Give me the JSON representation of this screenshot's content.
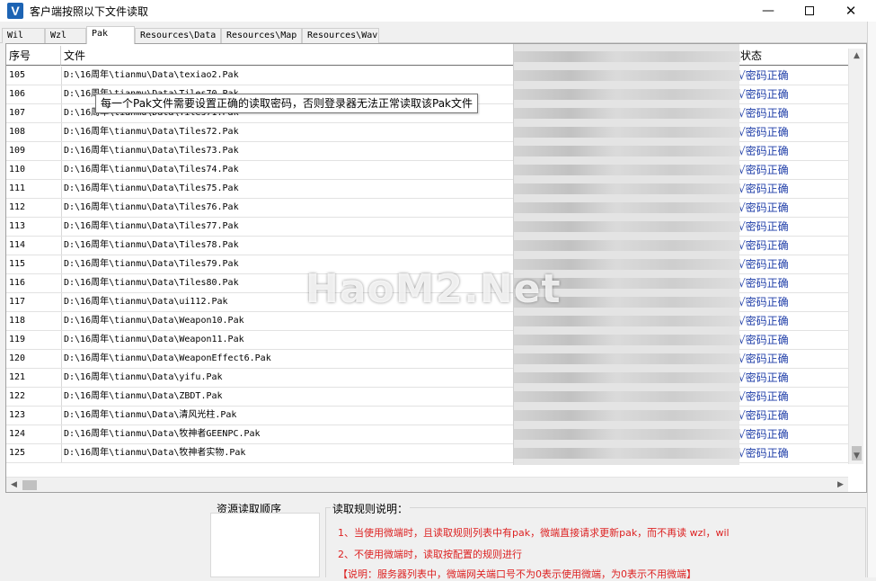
{
  "window": {
    "title": "客户端按照以下文件读取",
    "icon_letter": "V",
    "minimize": "—",
    "close": "✕"
  },
  "tabs": [
    "Wil",
    "Wzl",
    "Pak",
    "Resources\\Data",
    "Resources\\Map",
    "Resources\\Wav"
  ],
  "table": {
    "headers": {
      "index": "序号",
      "file": "文件",
      "status": "状态"
    },
    "rows": [
      {
        "index": "105",
        "file": "D:\\16周年\\tianmu\\Data\\texiao2.Pak",
        "status": "√密码正确"
      },
      {
        "index": "106",
        "file": "D:\\16周年\\tianmu\\Data\\Tiles70.Pak",
        "status": "√密码正确"
      },
      {
        "index": "107",
        "file": "D:\\16周年\\tianmu\\Data\\Tiles71.Pak",
        "status": "√密码正确"
      },
      {
        "index": "108",
        "file": "D:\\16周年\\tianmu\\Data\\Tiles72.Pak",
        "status": "√密码正确"
      },
      {
        "index": "109",
        "file": "D:\\16周年\\tianmu\\Data\\Tiles73.Pak",
        "status": "√密码正确"
      },
      {
        "index": "110",
        "file": "D:\\16周年\\tianmu\\Data\\Tiles74.Pak",
        "status": "√密码正确"
      },
      {
        "index": "111",
        "file": "D:\\16周年\\tianmu\\Data\\Tiles75.Pak",
        "status": "√密码正确"
      },
      {
        "index": "112",
        "file": "D:\\16周年\\tianmu\\Data\\Tiles76.Pak",
        "status": "√密码正确"
      },
      {
        "index": "113",
        "file": "D:\\16周年\\tianmu\\Data\\Tiles77.Pak",
        "status": "√密码正确"
      },
      {
        "index": "114",
        "file": "D:\\16周年\\tianmu\\Data\\Tiles78.Pak",
        "status": "√密码正确"
      },
      {
        "index": "115",
        "file": "D:\\16周年\\tianmu\\Data\\Tiles79.Pak",
        "status": "√密码正确"
      },
      {
        "index": "116",
        "file": "D:\\16周年\\tianmu\\Data\\Tiles80.Pak",
        "status": "√密码正确"
      },
      {
        "index": "117",
        "file": "D:\\16周年\\tianmu\\Data\\ui112.Pak",
        "status": "√密码正确"
      },
      {
        "index": "118",
        "file": "D:\\16周年\\tianmu\\Data\\Weapon10.Pak",
        "status": "√密码正确"
      },
      {
        "index": "119",
        "file": "D:\\16周年\\tianmu\\Data\\Weapon11.Pak",
        "status": "√密码正确"
      },
      {
        "index": "120",
        "file": "D:\\16周年\\tianmu\\Data\\WeaponEffect6.Pak",
        "status": "√密码正确"
      },
      {
        "index": "121",
        "file": "D:\\16周年\\tianmu\\Data\\yifu.Pak",
        "status": "√密码正确"
      },
      {
        "index": "122",
        "file": "D:\\16周年\\tianmu\\Data\\ZBDT.Pak",
        "status": "√密码正确"
      },
      {
        "index": "123",
        "file": "D:\\16周年\\tianmu\\Data\\清风光柱.Pak",
        "status": "√密码正确"
      },
      {
        "index": "124",
        "file": "D:\\16周年\\tianmu\\Data\\牧神者GEENPC.Pak",
        "status": "√密码正确"
      },
      {
        "index": "125",
        "file": "D:\\16周年\\tianmu\\Data\\牧神者实物.Pak",
        "status": "√密码正确"
      }
    ]
  },
  "tooltip": "每一个Pak文件需要设置正确的读取密码，否则登录器无法正常读取该Pak文件",
  "watermark": "HaoM2.Net",
  "bottom": {
    "order_label": "资源读取顺序",
    "rules_label": "读取规则说明：",
    "rules": [
      "1、当使用微端时，且读取规则列表中有pak，微端直接请求更新pak，而不再读 wzl，wil",
      "2、不使用微端时，读取按配置的规则进行",
      "【说明：服务器列表中，微端网关端口号不为0表示使用微端，为0表示不用微端】"
    ]
  },
  "colors": {
    "status_text": "#1f3ea8",
    "rules_text": "#dd2222",
    "app_icon": "#1d64b4"
  }
}
